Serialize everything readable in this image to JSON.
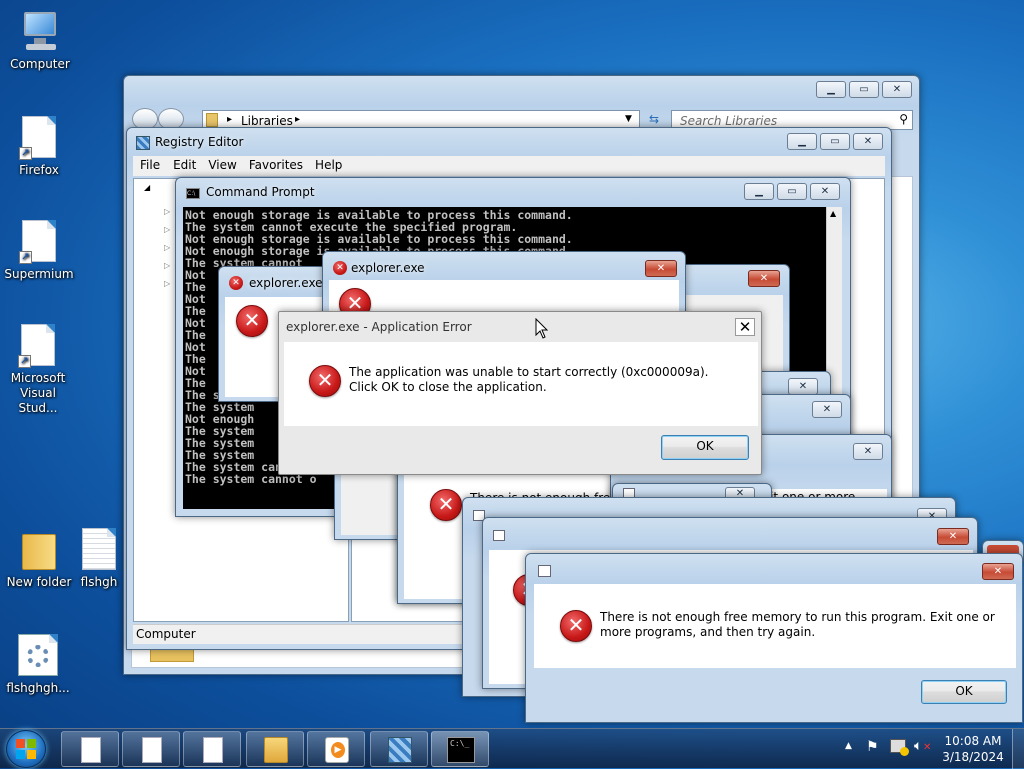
{
  "desktop": {
    "icons": [
      {
        "label": "Computer",
        "icon": "computer-icon"
      },
      {
        "label": "Firefox",
        "icon": "shortcut-file-icon"
      },
      {
        "label": "Supermium",
        "icon": "shortcut-file-icon"
      },
      {
        "label": "Microsoft Visual Stud...",
        "icon": "shortcut-file-icon"
      },
      {
        "label": "New folder",
        "icon": "folder-icon"
      },
      {
        "label": "flshgh",
        "icon": "text-file-icon"
      },
      {
        "label": "flshghgh...",
        "icon": "settings-file-icon"
      }
    ]
  },
  "explorer": {
    "address_root": "Libraries",
    "search_placeholder": "Search Libraries"
  },
  "regedit": {
    "title": "Registry Editor",
    "menu": [
      "File",
      "Edit",
      "View",
      "Favorites",
      "Help"
    ],
    "status": "Computer"
  },
  "cmd": {
    "title": "Command Prompt",
    "lines": [
      "Not enough storage is available to process this command.",
      "The system cannot execute the specified program.",
      "Not enough storage is available to process this command.",
      "Not enough storage is available to process this command.",
      "The system cannot",
      "Not",
      "The",
      "Not",
      "The",
      "Not",
      "The",
      "Not",
      "The",
      "Not",
      "The",
      "The system",
      "The system",
      "Not enough",
      "The system",
      "The system",
      "The system",
      "The system cannot",
      "The system cannot o"
    ]
  },
  "dialogs": {
    "explorer1_title": "explorer.exe",
    "explorer2_title": "explorer.exe",
    "app_error": {
      "title": "explorer.exe - Application Error",
      "message": "The application was unable to start correctly (0xc000009a). Click OK to close the application.",
      "ok": "OK"
    },
    "memory_partial_1": "There is not enough free m",
    "memory_partial_2": "xit one or more",
    "memory": {
      "message": "There is not enough free memory to run this program. Exit one or more programs, and then try again.",
      "ok": "OK"
    }
  },
  "taskbar": {
    "time": "10:08 AM",
    "date": "3/18/2024",
    "cmd_icon_text": "C:\\_"
  },
  "colors": {
    "close": "#c74b35",
    "error": "#c81818"
  }
}
